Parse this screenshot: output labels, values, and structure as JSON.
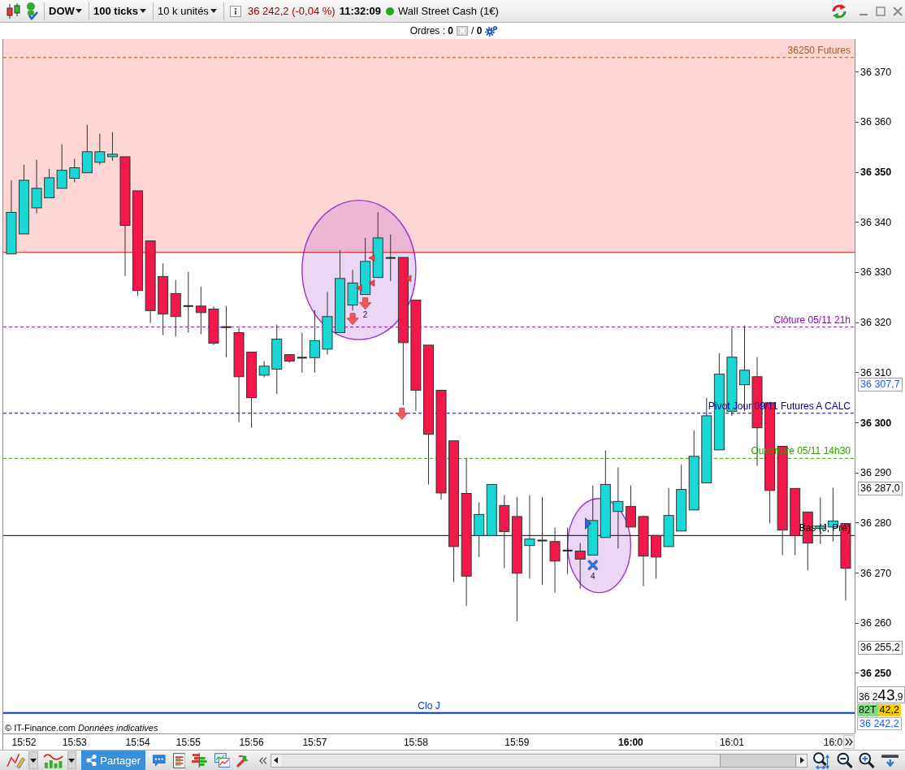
{
  "toolbar": {
    "symbol": "DOW",
    "period": "100 ticks",
    "quantity": "10 k unités",
    "quote": "36 242,2 (-0,04 %)",
    "time": "11:32:09",
    "market_online": true,
    "instrument": "Wall Street Cash (1€)"
  },
  "orders": {
    "pending": "Ordres : **0**",
    "positions": "/ **0**"
  },
  "chart": {
    "chart_data": {
      "type": "candlestick",
      "categories": [
        null,
        "15:52",
        null,
        null,
        null,
        "15:53",
        null,
        null,
        null,
        null,
        "15:54",
        null,
        null,
        null,
        "15:55",
        null,
        null,
        null,
        null,
        "15:56",
        null,
        null,
        null,
        null,
        "15:57",
        null,
        null,
        null,
        null,
        null,
        null,
        null,
        "15:58",
        null,
        null,
        null,
        null,
        null,
        null,
        null,
        "15:59",
        null,
        null,
        null,
        null,
        null,
        null,
        null,
        null,
        "16:00",
        null,
        null,
        null,
        null,
        null,
        null,
        null,
        "16:01",
        null,
        null,
        null,
        null,
        null,
        null,
        null,
        "16:0",
        null
      ],
      "ohlc": [
        [
          36333.7,
          36348.4,
          36333.7,
          36342.0
        ],
        [
          36337.7,
          36351.5,
          36337.7,
          36348.4
        ],
        [
          36342.9,
          36352.5,
          36341.8,
          36346.8
        ],
        [
          36344.9,
          36350.7,
          36344.9,
          36348.9
        ],
        [
          36346.8,
          36355.6,
          36346.8,
          36350.4
        ],
        [
          36348.8,
          36352.7,
          36348.0,
          36350.9
        ],
        [
          36349.9,
          36359.5,
          36349.9,
          36354.1
        ],
        [
          36352.0,
          36357.7,
          36351.5,
          36354.1
        ],
        [
          36353.1,
          36358.0,
          36352.3,
          36353.6
        ],
        [
          36353.1,
          36353.1,
          36329.3,
          36339.4
        ],
        [
          36346.3,
          36346.3,
          36325.3,
          36326.4
        ],
        [
          36336.3,
          36336.3,
          36319.9,
          36322.4
        ],
        [
          36329.2,
          36331.8,
          36317.5,
          36321.7
        ],
        [
          36325.8,
          36328.5,
          36317.2,
          36321.2
        ],
        [
          36323.3,
          36330.1,
          36318.0,
          36323.3
        ],
        [
          36323.3,
          36327.2,
          36317.7,
          36322.0
        ],
        [
          36322.7,
          36323.2,
          36315.5,
          36315.9
        ],
        [
          36319.1,
          36323.3,
          36313.1,
          36319.1
        ],
        [
          36318.0,
          36318.9,
          36300.1,
          36309.2
        ],
        [
          36314.1,
          36314.1,
          36299.0,
          36305.0
        ],
        [
          36309.5,
          36312.3,
          36309.1,
          36311.3
        ],
        [
          36310.7,
          36319.6,
          36305.8,
          36316.7
        ],
        [
          36313.6,
          36313.6,
          36312.0,
          36312.3
        ],
        [
          36313.0,
          36318.0,
          36310.0,
          36313.0
        ],
        [
          36313.0,
          36322.5,
          36310.0,
          36316.4
        ],
        [
          36314.7,
          36326.1,
          36313.6,
          36321.2
        ],
        [
          36318.0,
          36334.5,
          36318.0,
          36328.8
        ],
        [
          36323.5,
          36330.5,
          36322.4,
          36327.9
        ],
        [
          36325.6,
          36336.9,
          36325.6,
          36332.2
        ],
        [
          36329.0,
          36342.0,
          36329.0,
          36336.9
        ],
        [
          36332.9,
          36337.6,
          36328.3,
          36332.9
        ],
        [
          36333.0,
          36333.0,
          36303.5,
          36316.0
        ],
        [
          36324.5,
          36324.5,
          36302.4,
          36306.5
        ],
        [
          36315.5,
          36315.5,
          36287.7,
          36297.7
        ],
        [
          36306.5,
          36306.5,
          36284.7,
          36286.0
        ],
        [
          36296.4,
          36296.4,
          36268.2,
          36275.3
        ],
        [
          36285.9,
          36292.9,
          36263.5,
          36269.4
        ],
        [
          36277.5,
          36284.1,
          36273.2,
          36281.7
        ],
        [
          36277.5,
          36287.7,
          36277.5,
          36287.7
        ],
        [
          36283.5,
          36285.6,
          36271.0,
          36278.3
        ],
        [
          36281.3,
          36285.2,
          36260.4,
          36270.0
        ],
        [
          36275.5,
          36285.6,
          36268.9,
          36276.8
        ],
        [
          36276.5,
          36285.2,
          36267.7,
          36276.5
        ],
        [
          36276.3,
          36279.1,
          36266.1,
          36272.4
        ],
        [
          36274.5,
          36279.1,
          36269.8,
          36274.5
        ],
        [
          36274.4,
          36276.0,
          36266.9,
          36272.8
        ],
        [
          36273.6,
          36287.5,
          36273.6,
          36280.5
        ],
        [
          36277.1,
          36294.5,
          36277.1,
          36287.7
        ],
        [
          36282.3,
          36291.1,
          36274.9,
          36284.3
        ],
        [
          36283.3,
          36287.5,
          36279.2,
          36279.2
        ],
        [
          36281.3,
          36281.5,
          36267.4,
          36273.4
        ],
        [
          36277.5,
          36277.6,
          36268.9,
          36273.2
        ],
        [
          36275.3,
          36287.0,
          36275.3,
          36281.5
        ],
        [
          36278.4,
          36291.6,
          36278.4,
          36286.7
        ],
        [
          36282.6,
          36298.5,
          36282.6,
          36293.3
        ],
        [
          36288.0,
          36305.0,
          36288.0,
          36301.4
        ],
        [
          36294.6,
          36313.9,
          36294.6,
          36309.7
        ],
        [
          36302.3,
          36318.9,
          36301.4,
          36313.1
        ],
        [
          36307.6,
          36319.4,
          36302.3,
          36310.5
        ],
        [
          36309.2,
          36313.1,
          36291.4,
          36299.0
        ],
        [
          36304.0,
          36304.0,
          36279.9,
          36286.5
        ],
        [
          36295.3,
          36295.3,
          36273.6,
          36278.6
        ],
        [
          36286.9,
          36286.9,
          36273.6,
          36277.5
        ],
        [
          36282.2,
          36282.2,
          36270.5,
          36276.0
        ],
        [
          36278.9,
          36285.1,
          36275.8,
          36279.4
        ],
        [
          36279.2,
          36287.0,
          36276.3,
          36280.4
        ],
        [
          36279.9,
          36279.9,
          36264.5,
          36271.0
        ]
      ],
      "ylim": [
        36238.0,
        36376.6
      ],
      "yticks": [
        {
          "value": 36370,
          "label": "36 370"
        },
        {
          "value": 36360,
          "label": "36 360"
        },
        {
          "value": 36350,
          "label": "36 350"
        },
        {
          "value": 36340,
          "label": "36 340"
        },
        {
          "value": 36330,
          "label": "36 330"
        },
        {
          "value": 36320,
          "label": "36 320"
        },
        {
          "value": 36310,
          "label": "36 310"
        },
        {
          "value": 36300,
          "label": "36 300"
        },
        {
          "value": 36290,
          "label": "36 290"
        },
        {
          "value": 36280,
          "label": "36 280"
        },
        {
          "value": 36270,
          "label": "36 270"
        },
        {
          "value": 36260,
          "label": "36 260"
        },
        {
          "value": 36250,
          "label": "36 250"
        }
      ],
      "bands": [
        {
          "axis": "y",
          "from": 36334.0,
          "to": 36376.6,
          "color": "#ffd6d6"
        }
      ],
      "ref_lines": [
        {
          "axis": "y",
          "value": 36372.9,
          "label": "36250 Futures",
          "color": "#b05a1e"
        },
        {
          "axis": "y",
          "value": 36334.0,
          "color": "#e01010"
        },
        {
          "axis": "y",
          "value": 36319.1,
          "label": "Clôture 05/11 21h",
          "color": "#9900cc"
        },
        {
          "axis": "y",
          "value": 36301.9,
          "label": "Pivot Jour 09/11 Futures A CALC",
          "color": "#000099"
        },
        {
          "axis": "y",
          "value": 36292.9,
          "label": "Ouverture 05/11 14h30",
          "color": "#339900"
        },
        {
          "axis": "y",
          "value": 36277.5,
          "label": "Bas (J, Pré)",
          "color": "#000000"
        },
        {
          "axis": "y",
          "value": 36242.1,
          "label": "Clo J",
          "color": "#0033ee"
        }
      ]
    },
    "signal_counts": [
      "2",
      "4"
    ],
    "price_tags": [
      {
        "text": "36 307,7",
        "color": "#1a5cff"
      },
      {
        "text": "36 287,0",
        "color": "#000000"
      },
      {
        "text": "36 255,2",
        "color": "#000000"
      }
    ],
    "last_price": {
      "head": "36 2",
      "main": "43",
      "tail": ",9"
    },
    "counters": [
      {
        "text": "82T",
        "color": "#7ee07e"
      },
      {
        "text": "42,2",
        "color": "#ffcc00"
      }
    ],
    "close_tag": "36 242,2",
    "footer_note": "© IT-Finance.com *Données indicatives*"
  },
  "bottom_toolbar": {
    "share_label": "Partager"
  }
}
